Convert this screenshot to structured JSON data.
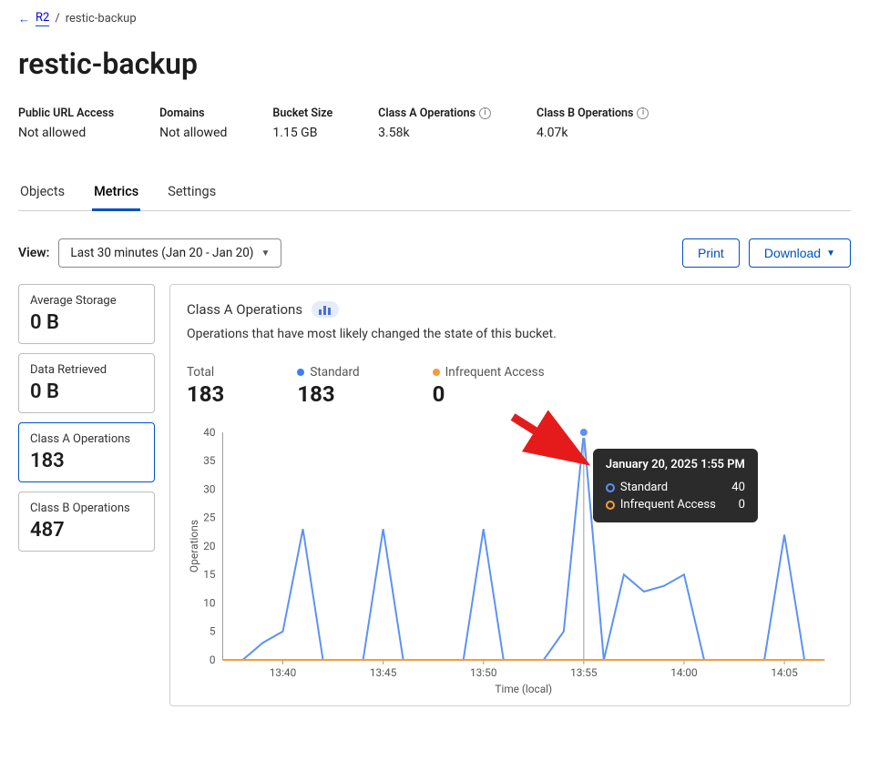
{
  "breadcrumb": {
    "root": "R2",
    "current": "restic-backup"
  },
  "page_title": "restic-backup",
  "summary": [
    {
      "label": "Public URL Access",
      "value": "Not allowed",
      "info": false
    },
    {
      "label": "Domains",
      "value": "Not allowed",
      "info": false
    },
    {
      "label": "Bucket Size",
      "value": "1.15 GB",
      "info": false
    },
    {
      "label": "Class A Operations",
      "value": "3.58k",
      "info": true
    },
    {
      "label": "Class B Operations",
      "value": "4.07k",
      "info": true
    }
  ],
  "tabs": [
    "Objects",
    "Metrics",
    "Settings"
  ],
  "active_tab": 1,
  "view": {
    "label": "View:",
    "selected": "Last 30 minutes (Jan 20 - Jan 20)"
  },
  "actions": {
    "print": "Print",
    "download": "Download"
  },
  "stat_cards": [
    {
      "label": "Average Storage",
      "value": "0 B",
      "active": false
    },
    {
      "label": "Data Retrieved",
      "value": "0 B",
      "active": false
    },
    {
      "label": "Class A Operations",
      "value": "183",
      "active": true
    },
    {
      "label": "Class B Operations",
      "value": "487",
      "active": false
    }
  ],
  "chart": {
    "title": "Class A Operations",
    "subtitle": "Operations that have most likely changed the state of this bucket.",
    "legend": [
      {
        "key": "total",
        "label": "Total",
        "value": "183",
        "dot": null
      },
      {
        "key": "standard",
        "label": "Standard",
        "value": "183",
        "dot": "blue"
      },
      {
        "key": "infrequent",
        "label": "Infrequent Access",
        "value": "0",
        "dot": "orange"
      }
    ],
    "xlabel": "Time (local)",
    "ylabel": "Operations",
    "tooltip": {
      "title": "January 20, 2025 1:55 PM",
      "rows": [
        {
          "label": "Standard",
          "value": "40",
          "color": "#5b91f5"
        },
        {
          "label": "Infrequent Access",
          "value": "0",
          "color": "#f59b3d"
        }
      ]
    }
  },
  "chart_data": {
    "type": "line",
    "title": "Class A Operations",
    "xlabel": "Time (local)",
    "ylabel": "Operations",
    "ylim": [
      0,
      40
    ],
    "x_ticks": [
      "13:40",
      "13:45",
      "13:50",
      "13:55",
      "14:00",
      "14:05"
    ],
    "x_minutes": [
      37,
      38,
      39,
      40,
      41,
      42,
      43,
      44,
      45,
      46,
      47,
      48,
      49,
      50,
      51,
      52,
      53,
      54,
      55,
      56,
      57,
      58,
      59,
      60,
      61,
      62,
      63,
      64,
      65,
      66,
      67
    ],
    "series": [
      {
        "name": "Standard",
        "color": "#5b91f5",
        "values": [
          0,
          0,
          3,
          5,
          23,
          0,
          0,
          0,
          23,
          0,
          0,
          0,
          0,
          23,
          0,
          0,
          0,
          5,
          40,
          0,
          15,
          12,
          13,
          15,
          0,
          0,
          0,
          0,
          22,
          0,
          0
        ]
      },
      {
        "name": "Infrequent Access",
        "color": "#f59b3d",
        "values": [
          0,
          0,
          0,
          0,
          0,
          0,
          0,
          0,
          0,
          0,
          0,
          0,
          0,
          0,
          0,
          0,
          0,
          0,
          0,
          0,
          0,
          0,
          0,
          0,
          0,
          0,
          0,
          0,
          0,
          0,
          0
        ]
      }
    ],
    "hover_index": 18
  }
}
